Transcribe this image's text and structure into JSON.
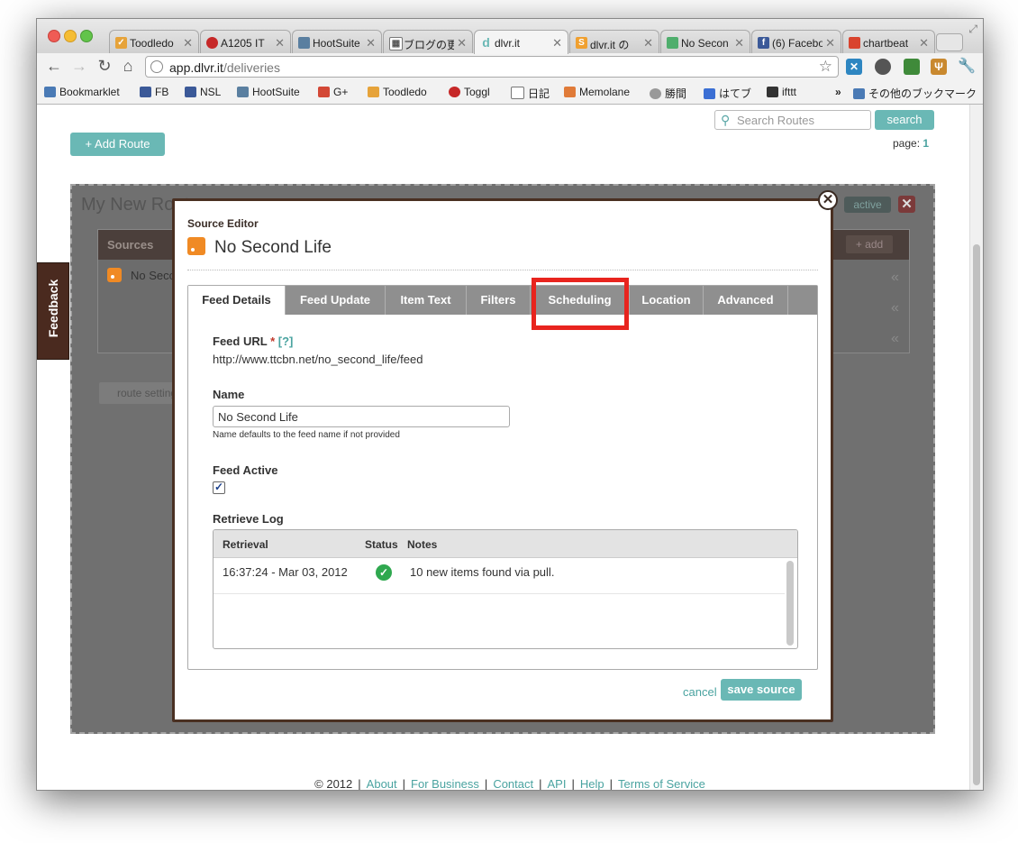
{
  "browser": {
    "tabs": [
      {
        "label": "Toodledo",
        "icon": "toodledo-icon",
        "color": "#e6a33a"
      },
      {
        "label": "A1205 IT",
        "icon": "toggl-icon",
        "color": "#c62828"
      },
      {
        "label": "HootSuite",
        "icon": "hootsuite-icon",
        "color": "#5a7fa0"
      },
      {
        "label": "ブログの更",
        "icon": "grid-icon",
        "color": "#777777"
      },
      {
        "label": "dlvr.it",
        "icon": "dlvr-icon",
        "color": "#6ab8b5"
      },
      {
        "label": "dlvr.it の",
        "icon": "blogger-icon",
        "color": "#f0a030"
      },
      {
        "label": "No Secon",
        "icon": "nosecondlife-icon",
        "color": "#4fae6d"
      },
      {
        "label": "(6) Facebo",
        "icon": "facebook-icon",
        "color": "#3b5998"
      },
      {
        "label": "chartbeat",
        "icon": "chartbeat-icon",
        "color": "#d9442e"
      }
    ],
    "url_host": "app.dlvr.it",
    "url_path": "/deliveries",
    "bookmarks": [
      {
        "label": "Bookmarklet",
        "color": "#4a7ab5"
      },
      {
        "label": "FB",
        "color": "#3b5998"
      },
      {
        "label": "NSL",
        "color": "#3b5998"
      },
      {
        "label": "HootSuite",
        "color": "#5a7fa0"
      },
      {
        "label": "G+",
        "color": "#d34836"
      },
      {
        "label": "Toodledo",
        "color": "#e6a33a"
      },
      {
        "label": "Toggl",
        "color": "#c62828"
      },
      {
        "label": "日記",
        "color": "#777777"
      },
      {
        "label": "Memolane",
        "color": "#e07b39"
      },
      {
        "label": "勝間",
        "color": "#999999"
      },
      {
        "label": "はてブ",
        "color": "#3b6fd4"
      },
      {
        "label": "ifttt",
        "color": "#333333"
      },
      {
        "label": "その他のブックマーク",
        "color": "#4a7ab5"
      }
    ],
    "chevron_more": "»"
  },
  "page": {
    "search_placeholder": "Search Routes",
    "search_button": "search",
    "page_label": "page:",
    "page_number": "1",
    "add_route": "+ Add Route",
    "route_title": "My New Route",
    "route_status": "active",
    "sources_header": "Sources",
    "add_source": "+ add",
    "source_row": "No Second Life",
    "route_settings": "route settings",
    "feedback": "Feedback"
  },
  "modal": {
    "title": "Source Editor",
    "feed_name": "No Second Life",
    "tabs": [
      "Feed Details",
      "Feed Update",
      "Item Text",
      "Filters",
      "Scheduling",
      "Location",
      "Advanced"
    ],
    "feed_url_label": "Feed URL",
    "required_mark": "*",
    "help_link": "[?]",
    "feed_url": "http://www.ttcbn.net/no_second_life/feed",
    "name_label": "Name",
    "name_value": "No Second Life",
    "name_hint": "Name defaults to the feed name if not provided",
    "active_label": "Feed Active",
    "active_checked": true,
    "log_label": "Retrieve Log",
    "log_columns": [
      "Retrieval",
      "Status",
      "Notes"
    ],
    "log_rows": [
      {
        "retrieval": "16:37:24 - Mar 03, 2012",
        "status": "ok",
        "notes": "10 new items found via pull."
      }
    ],
    "cancel": "cancel",
    "save": "save source",
    "highlighted_tab": "Scheduling"
  },
  "footer": {
    "copyright": "© 2012",
    "links": [
      "About",
      "For Business",
      "Contact",
      "API",
      "Help",
      "Terms of Service"
    ]
  },
  "colors": {
    "accent": "#6ab8b5",
    "highlight": "#e8241e",
    "modal_border": "#4a3022"
  }
}
